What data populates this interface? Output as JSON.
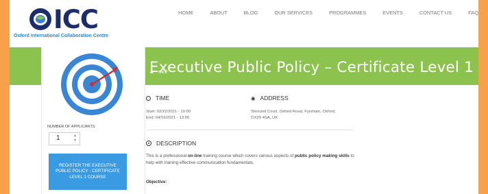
{
  "header": {
    "brand": "ICC",
    "tagline": "Oxford International Collaboration Centre",
    "nav": [
      "HOME",
      "ABOUT",
      "BLOG",
      "OUR SERVICES",
      "PROGRAMMES",
      "EVENTS",
      "CONTACT US",
      "FAQ"
    ]
  },
  "hero": {
    "title": "Executive Public Policy – Certificate Level 1",
    "author": "oicc"
  },
  "sidebar": {
    "applicants_label": "NUMBER OF APPLICANTS",
    "applicants_value": "1",
    "register_label": "REGISTER THE EXECUTIVE PUBLIC POLICY - CERTIFICATE LEVEL 1 COURSE"
  },
  "time": {
    "heading": "TIME",
    "start": "Start: 02/22/2021 - 10:00",
    "end": "End: 04/16/2021 - 13:00"
  },
  "address": {
    "heading": "ADDRESS",
    "text": "Shround Court, Oxford Road, Fyrsham, Oxford, OX29 4SA, UK"
  },
  "description": {
    "heading": "DESCRIPTION",
    "p1": "This is a professional ",
    "p1_bold": "on-line",
    "p2": " training course which covers various aspects of ",
    "p2_bold": "public policy making skills",
    "p3": " to help with training effective communication fundamentals.",
    "objective": "Objective:"
  },
  "colors": {
    "accent_green": "#8cc34e",
    "button_blue": "#3a9be3",
    "brand_navy": "#1c2d6b",
    "frame_orange": "#f7a24a"
  }
}
